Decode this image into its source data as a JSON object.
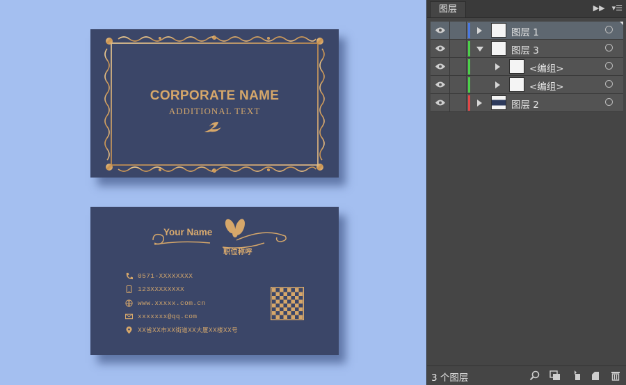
{
  "front_card": {
    "corporate_name": "CORPORATE NAME",
    "additional_text": "ADDITIONAL TEXT"
  },
  "back_card": {
    "your_name": "Your Name",
    "job_title": "职位称呼",
    "contacts": [
      {
        "icon": "phone-icon",
        "text": "0571-XXXXXXXX"
      },
      {
        "icon": "mobile-icon",
        "text": "123XXXXXXXX"
      },
      {
        "icon": "web-icon",
        "text": "www.xxxxx.com.cn"
      },
      {
        "icon": "mail-icon",
        "text": "xxxxxxx@qq.com"
      },
      {
        "icon": "location-icon",
        "text": "XX省XX市XX街道XX大厦XX楼XX号"
      }
    ]
  },
  "layers_panel": {
    "tab_label": "图层",
    "layers": [
      {
        "name": "图层 1",
        "color": "#4a78e0",
        "expanded": false,
        "selected": true
      },
      {
        "name": "图层 3",
        "color": "#4cd04a",
        "expanded": true,
        "selected": false
      },
      {
        "name": "<编组>",
        "color": "#4cd04a",
        "expanded": false,
        "selected": false
      },
      {
        "name": "<编组>",
        "color": "#4cd04a",
        "expanded": false,
        "selected": false
      },
      {
        "name": "图层 2",
        "color": "#e04848",
        "expanded": false,
        "selected": false
      }
    ],
    "layer_count": "3 个图层",
    "footer_icons": [
      "search-icon",
      "clipping-mask-icon",
      "sublayer-icon",
      "new-layer-icon",
      "trash-icon"
    ]
  },
  "colors": {
    "background": "#a4bff0",
    "card": "#3b4668",
    "gold": "#d6a76a",
    "panel": "#454545"
  }
}
